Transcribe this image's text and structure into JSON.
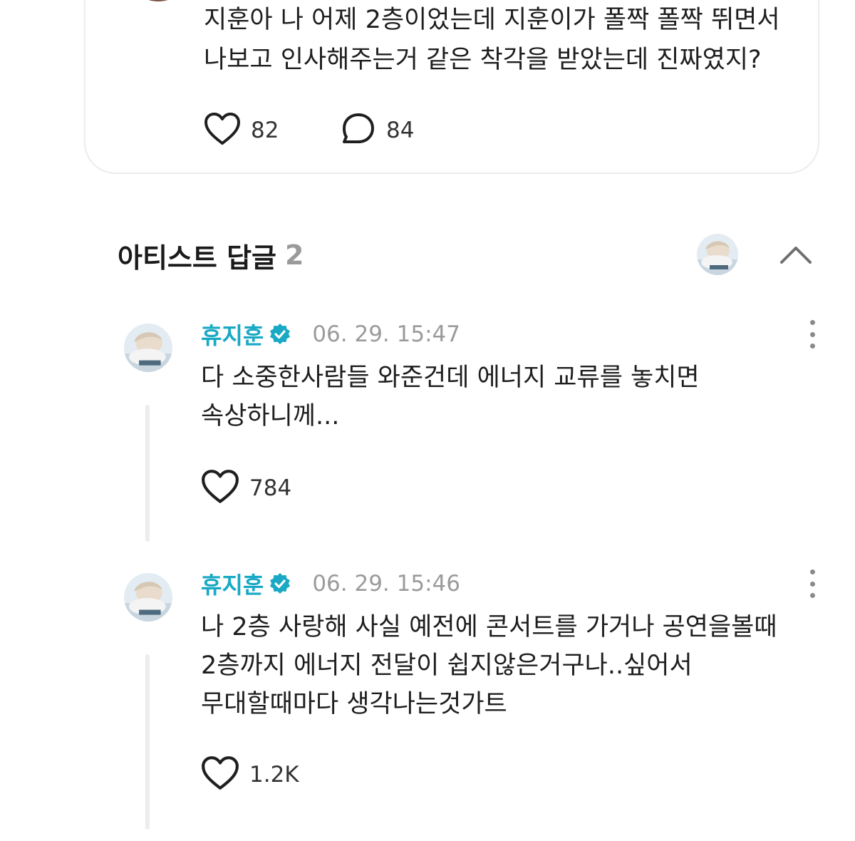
{
  "post": {
    "text_lines": [
      "지훈아 나 어제 2층이었는데 지훈이가 폴짝 폴짝 뛰면서",
      "나보고 인사해주는거 같은 착각을 받았는데 진짜였지?"
    ],
    "like_count": "82",
    "comment_count": "84"
  },
  "replies_section": {
    "title": "아티스트 답글",
    "count": "2"
  },
  "replies": [
    {
      "name": "휴지훈",
      "date": "06. 29. 15:47",
      "text_lines": [
        "다 소중한사람들 와준건데 에너지 교류를 놓치면",
        "속상하니께..."
      ],
      "like_count": "784"
    },
    {
      "name": "휴지훈",
      "date": "06. 29. 15:46",
      "text_lines": [
        "나 2층 사랑해 사실 예전에 콘서트를 가거나 공연을볼때",
        "2층까지 에너지 전달이 쉽지않은거구나..싶어서",
        "무대할때마다 생각나는것가트"
      ],
      "like_count": "1.2K"
    }
  ],
  "colors": {
    "artist_name": "#19a9c4",
    "verified_badge": "#19a9c4",
    "meta_gray": "#9b9b9b",
    "thread_line": "#ededed"
  },
  "icons": {
    "like": "heart-outline-icon",
    "comment": "speech-bubble-icon",
    "verified": "verified-check-icon",
    "more": "vertical-dots-icon",
    "collapse": "chevron-up-icon"
  }
}
